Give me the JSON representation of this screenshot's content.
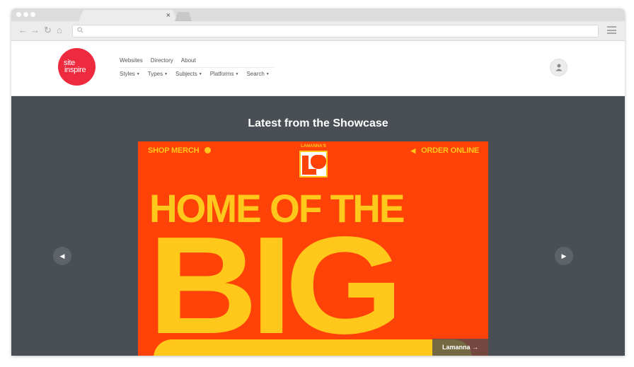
{
  "browser": {
    "tab_close": "×",
    "nav": {
      "back": "←",
      "forward": "→",
      "reload": "↻",
      "home": "⌂"
    },
    "address_value": ""
  },
  "header": {
    "logo": {
      "line1": "site",
      "line2": "inspire",
      "color": "#ee2a3f"
    },
    "nav_primary": [
      "Websites",
      "Directory",
      "About"
    ],
    "nav_secondary": [
      "Styles",
      "Types",
      "Subjects",
      "Platforms",
      "Search"
    ],
    "caret": "▼"
  },
  "showcase": {
    "title": "Latest from the Showcase",
    "prev_arrow": "◀",
    "next_arrow": "▶",
    "background": "#4a4e55",
    "slide": {
      "top_left": "SHOP MERCH",
      "top_right": "ORDER ONLINE",
      "logo_text": "LAMANNA'S",
      "headline_1": "HOME OF THE",
      "headline_2": "BIG",
      "caption": "Lamanna →",
      "bg_color": "#ff4208",
      "text_color": "#ffc81a"
    }
  }
}
